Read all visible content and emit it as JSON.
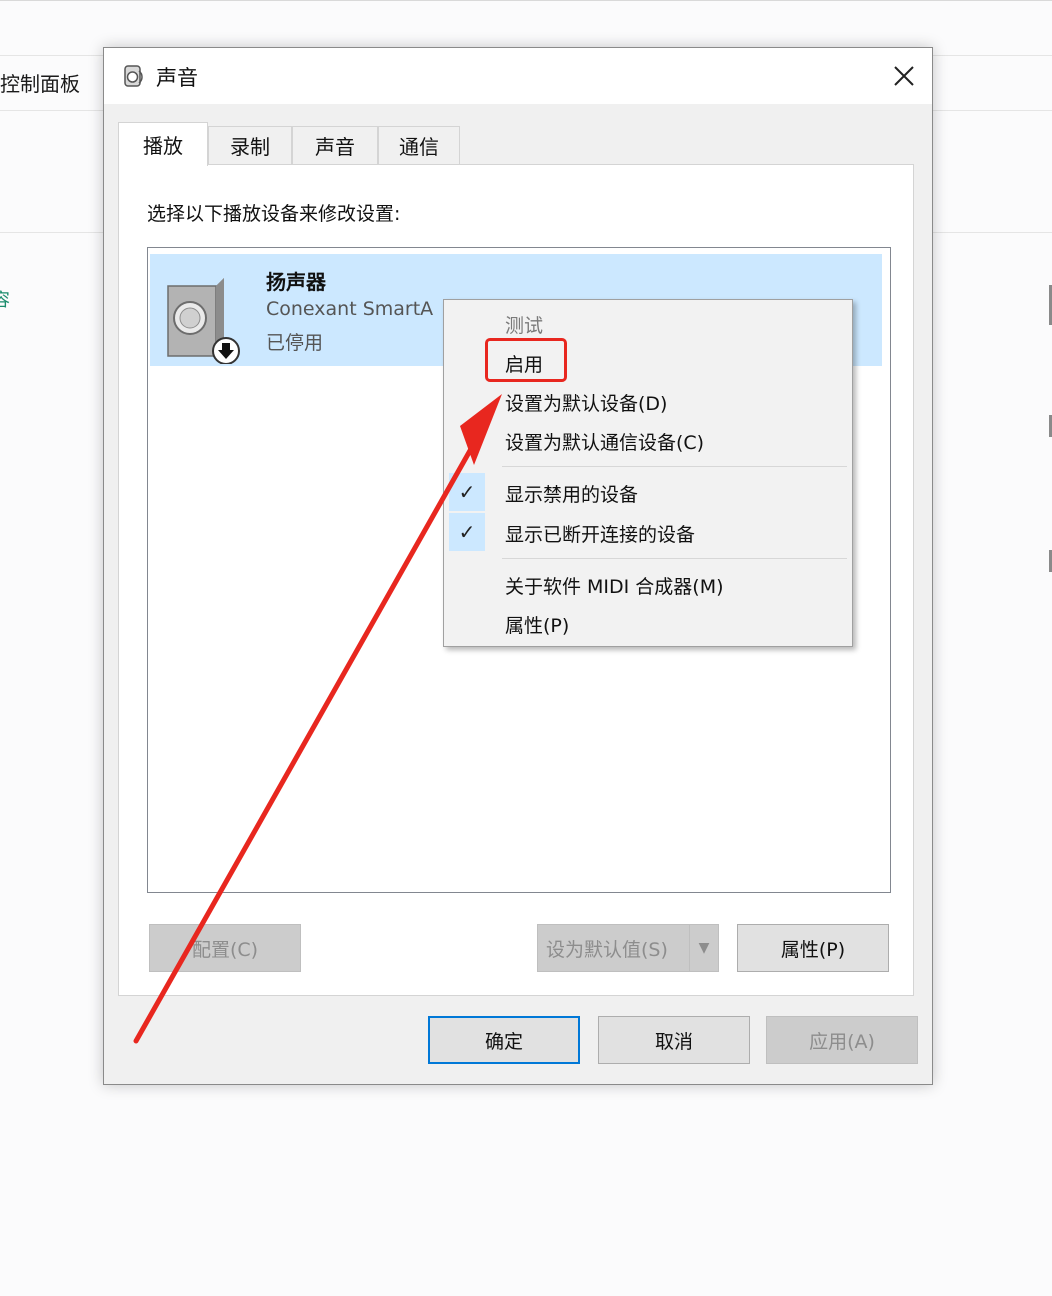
{
  "background": {
    "window_title": "控制面板",
    "link_fragment": "容"
  },
  "dialog": {
    "title": "声音",
    "close_icon": "close-icon",
    "tabs": [
      {
        "label": "播放",
        "active": true
      },
      {
        "label": "录制",
        "active": false
      },
      {
        "label": "声音",
        "active": false
      },
      {
        "label": "通信",
        "active": false
      }
    ],
    "instruction": "选择以下播放设备来修改设置:",
    "device": {
      "name": "扬声器",
      "driver": "Conexant SmartA",
      "status": "已停用",
      "icon": "speaker-disabled-icon"
    },
    "buttons": {
      "configure": "配置(C)",
      "set_default": "设为默认值(S)",
      "properties": "属性(P)",
      "ok": "确定",
      "cancel": "取消",
      "apply": "应用(A)"
    }
  },
  "context_menu": {
    "items": [
      {
        "label": "测试",
        "enabled": false
      },
      {
        "label": "启用",
        "enabled": true,
        "highlighted": true
      },
      {
        "label": "设置为默认设备(D)",
        "enabled": true
      },
      {
        "label": "设置为默认通信设备(C)",
        "enabled": true
      },
      {
        "label": "显示禁用的设备",
        "checked": true
      },
      {
        "label": "显示已断开连接的设备",
        "checked": true
      },
      {
        "label": "关于软件 MIDI 合成器(M)",
        "enabled": true
      },
      {
        "label": "属性(P)",
        "enabled": true
      }
    ],
    "check_icon": "checkmark-icon"
  },
  "annotation": {
    "color": "#e8271f"
  }
}
